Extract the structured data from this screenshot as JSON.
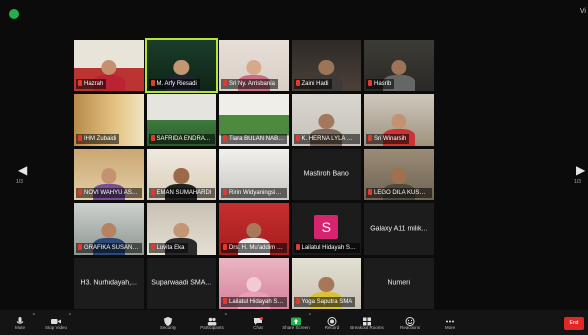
{
  "top": {
    "view_label": "Vi"
  },
  "gallery": {
    "tiles": [
      {
        "name": "Hazrah",
        "scene": "room"
      },
      {
        "name": "M. Arfy Riesadi",
        "scene": "studio"
      },
      {
        "name": "Sri Ny. Arrisbania",
        "scene": "pink"
      },
      {
        "name": "Zaini Hadi",
        "scene": "office"
      },
      {
        "name": "Hasrib",
        "scene": "office2"
      },
      {
        "name": "",
        "scene": "empty"
      },
      {
        "name": "IHM Zubaidi",
        "scene": "curtain"
      },
      {
        "name": "SAFRIDA ENDRA ANHARI",
        "scene": "classroom"
      },
      {
        "name": "Tiara BULAN NABILA",
        "scene": "board"
      },
      {
        "name": "K. HERNA LYLA NOOR",
        "scene": "wall"
      },
      {
        "name": "Sri Winarsih",
        "scene": "room2"
      },
      {
        "name": "",
        "scene": "empty"
      },
      {
        "name": "NOVI WAHYU ASMARA",
        "scene": "hijab"
      },
      {
        "name": "EMAN SUMAHARDI",
        "scene": "teacher"
      },
      {
        "name": "Ririn Widyaningsih Kak...",
        "scene": "ceiling",
        "plain": true
      },
      {
        "name": "Masfiroh Bano",
        "scene": "plain"
      },
      {
        "name": "LEGO DILA KUSUMA",
        "scene": "man"
      },
      {
        "name": "",
        "scene": "empty"
      },
      {
        "name": "GRAFIKA SUSANTO",
        "scene": "youngman"
      },
      {
        "name": "Luvita Eka",
        "scene": "woman2"
      },
      {
        "name": "Drs. H. Mu'addim Mas...",
        "scene": "redbg"
      },
      {
        "name": "Lailatul Hidayah SMA ...",
        "scene": "avatar-s"
      },
      {
        "name": "Galaxy A11 milik...",
        "scene": "plain"
      },
      {
        "name": "",
        "scene": "empty"
      },
      {
        "name": "H3. Nurhidayah,...",
        "scene": "plain"
      },
      {
        "name": "Suparwaadi SMA...",
        "scene": "plain"
      },
      {
        "name": "Lailatul Hidayah SMA ...",
        "scene": "pinkmask"
      },
      {
        "name": "Yoga Saputra SMA",
        "scene": "yellowshirt"
      },
      {
        "name": "Numeri",
        "scene": "plain"
      },
      {
        "name": "",
        "scene": "empty"
      }
    ]
  },
  "toolbar": {
    "items": [
      {
        "label": "Mute",
        "icon": "microphone-icon",
        "caret": true
      },
      {
        "label": "Stop Video",
        "icon": "video-camera-icon",
        "caret": true
      },
      {
        "label": "Security",
        "icon": "shield-icon"
      },
      {
        "label": "Participants",
        "icon": "participants-icon",
        "caret": true
      },
      {
        "label": "Chat",
        "icon": "chat-icon"
      },
      {
        "label": "Share Screen",
        "icon": "share-screen-icon",
        "caret": true
      },
      {
        "label": "Record",
        "icon": "record-icon"
      },
      {
        "label": "Breakout Rooms",
        "icon": "breakout-rooms-icon"
      },
      {
        "label": "Reactions",
        "icon": "reactions-icon"
      },
      {
        "label": "More",
        "icon": "more-icon"
      }
    ],
    "end_label": "End"
  },
  "nav": {
    "left_page": "1/3",
    "right_page": "1/3"
  },
  "colors": {
    "active_speaker": "#b7e23a",
    "end": "#e02828",
    "mic_muted": "#e23a2f",
    "avatar_s": "#d6246e"
  }
}
